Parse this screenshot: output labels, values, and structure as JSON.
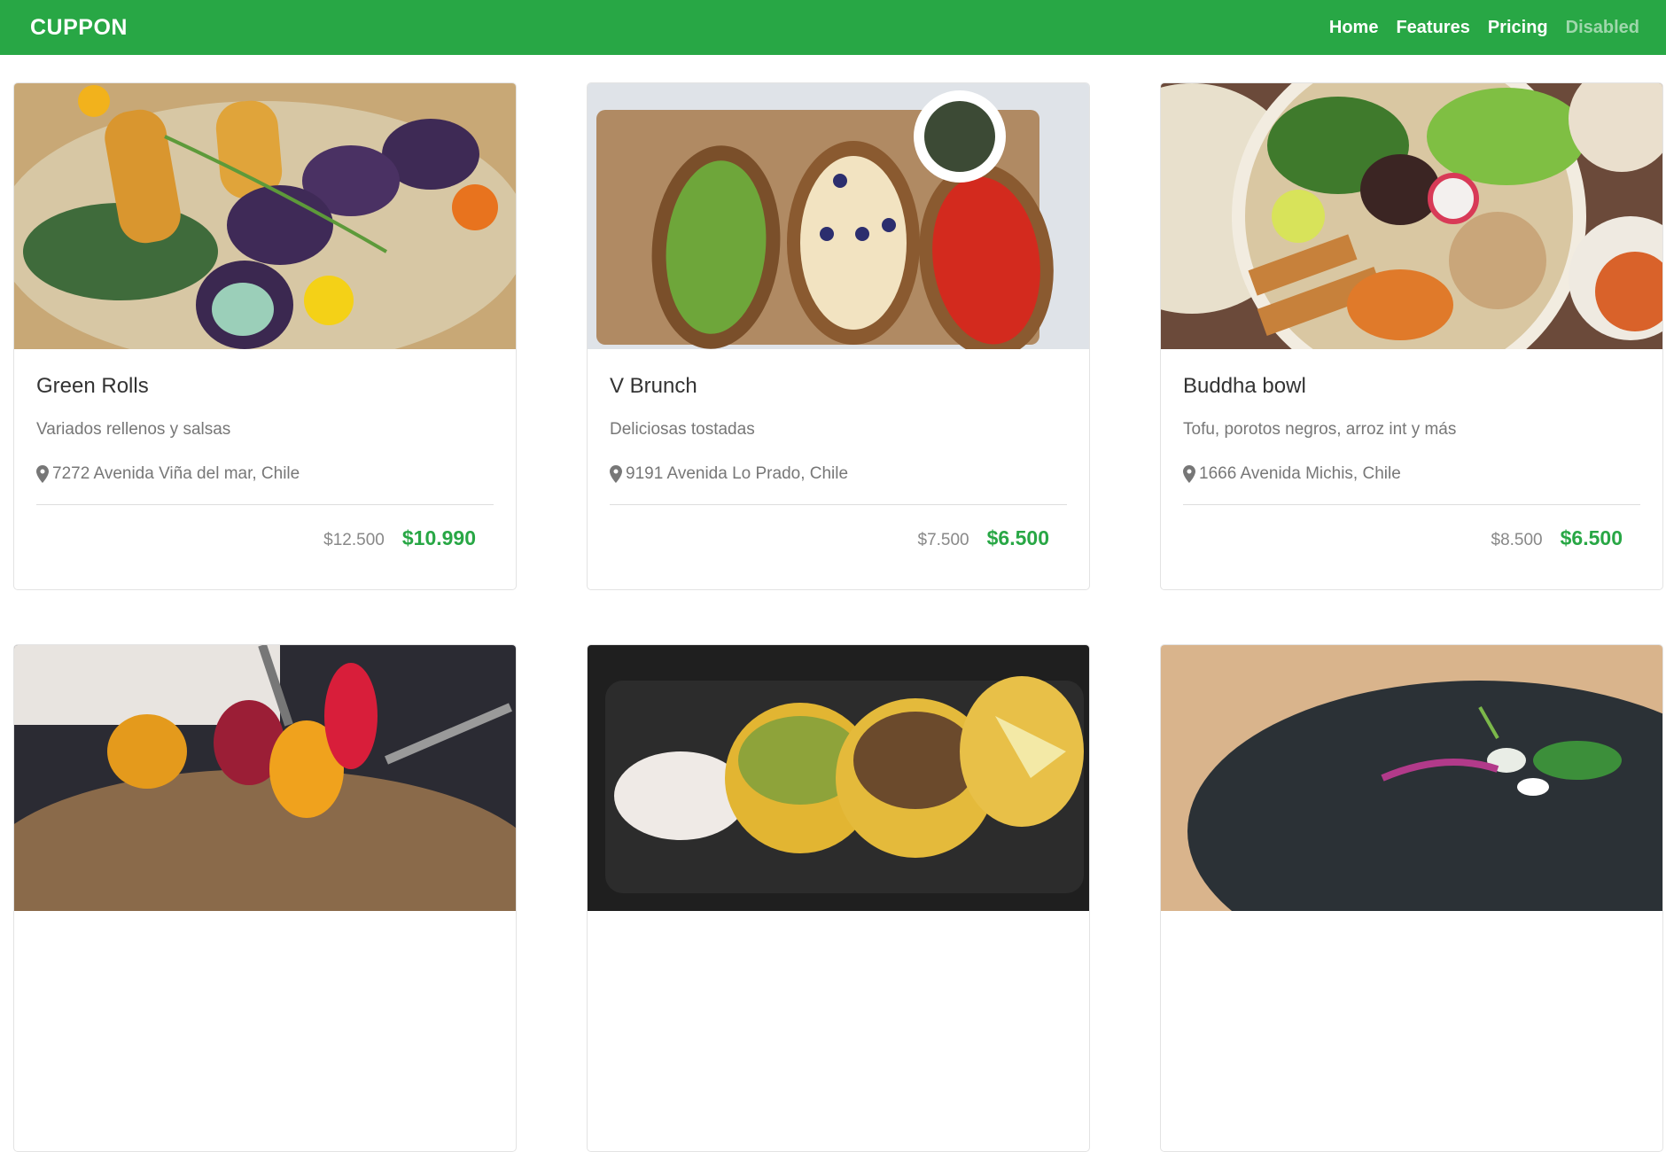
{
  "navbar": {
    "brand": "CUPPON",
    "links": [
      {
        "label": "Home"
      },
      {
        "label": "Features"
      },
      {
        "label": "Pricing"
      },
      {
        "label": "Disabled"
      }
    ],
    "colors": {
      "background": "#28a745",
      "link": "#ffffff"
    }
  },
  "cards": [
    {
      "title": "Green Rolls",
      "description": "Variados rellenos y salsas",
      "address": "7272 Avenida Viña del mar, Chile",
      "old_price": "$12.500",
      "new_price": "$10.990"
    },
    {
      "title": "V Brunch",
      "description": "Deliciosas tostadas",
      "address": "9191 Avenida Lo Prado, Chile",
      "old_price": "$7.500",
      "new_price": "$6.500"
    },
    {
      "title": "Buddha bowl",
      "description": "Tofu, porotos negros, arroz int y más",
      "address": "1666 Avenida Michis, Chile",
      "old_price": "$8.500",
      "new_price": "$6.500"
    },
    {
      "title": "",
      "description": "",
      "address": "",
      "old_price": "",
      "new_price": ""
    },
    {
      "title": "",
      "description": "",
      "address": "",
      "old_price": "",
      "new_price": ""
    },
    {
      "title": "",
      "description": "",
      "address": "",
      "old_price": "",
      "new_price": ""
    }
  ],
  "icons": {
    "location": "map-marker-icon"
  },
  "accent_color": "#28a745"
}
